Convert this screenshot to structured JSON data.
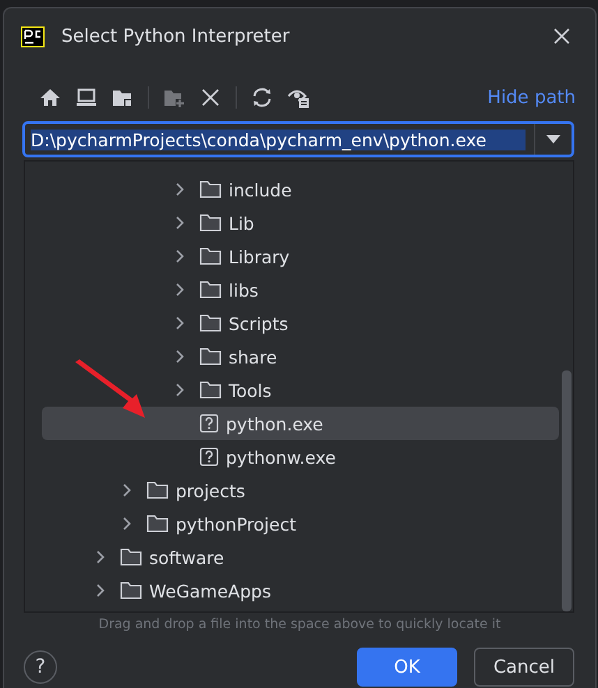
{
  "window": {
    "title": "Select Python Interpreter"
  },
  "toolbar": {
    "buttons": [
      {
        "kind": "home",
        "disabled": false
      },
      {
        "kind": "desktop",
        "disabled": false
      },
      {
        "kind": "project",
        "disabled": false
      },
      {
        "kind": "separator",
        "disabled": false
      },
      {
        "kind": "new-folder",
        "disabled": true
      },
      {
        "kind": "delete",
        "disabled": false
      },
      {
        "kind": "separator",
        "disabled": false
      },
      {
        "kind": "refresh",
        "disabled": false
      },
      {
        "kind": "show-hidden",
        "disabled": false
      }
    ],
    "hide_path": "Hide path"
  },
  "path_field": {
    "value": "D:\\pycharmProjects\\conda\\pycharm_env\\python.exe"
  },
  "tree": [
    {
      "children": [
        {
          "children": [
            {
              "children": [
                {
                  "label": "include",
                  "kind": "folder",
                  "expanded": false,
                  "selected": false
                },
                {
                  "label": "Lib",
                  "kind": "folder",
                  "expanded": false,
                  "selected": false
                },
                {
                  "label": "Library",
                  "kind": "folder",
                  "expanded": false,
                  "selected": false
                },
                {
                  "label": "libs",
                  "kind": "folder",
                  "expanded": false,
                  "selected": false
                },
                {
                  "label": "Scripts",
                  "kind": "folder",
                  "expanded": false,
                  "selected": false
                },
                {
                  "label": "share",
                  "kind": "folder",
                  "expanded": false,
                  "selected": false
                },
                {
                  "label": "Tools",
                  "kind": "folder",
                  "expanded": false,
                  "selected": false
                },
                {
                  "label": "python.exe",
                  "kind": "file",
                  "selected": true
                },
                {
                  "label": "pythonw.exe",
                  "kind": "file",
                  "selected": false
                }
              ]
            }
          ]
        },
        {
          "label": "projects",
          "kind": "folder",
          "expanded": false,
          "selected": false
        },
        {
          "label": "pythonProject",
          "kind": "folder",
          "expanded": false,
          "selected": false
        }
      ]
    },
    {
      "label": "software",
      "kind": "folder",
      "expanded": false,
      "selected": false
    },
    {
      "label": "WeGameApps",
      "kind": "folder",
      "expanded": false,
      "selected": false
    }
  ],
  "hint": "Drag and drop a file into the space above to quickly locate it",
  "buttons": [
    {
      "label": "OK",
      "kind": "primary"
    },
    {
      "label": "Cancel",
      "kind": "secondary"
    }
  ],
  "help": "?"
}
